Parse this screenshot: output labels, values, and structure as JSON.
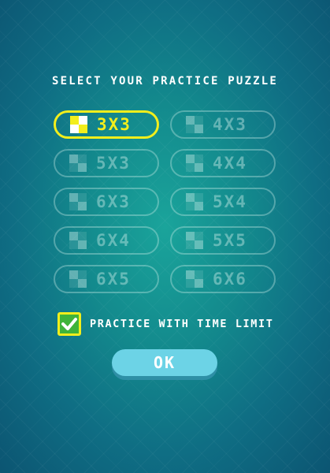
{
  "title": "SELECT YOUR PRACTICE PUZZLE",
  "puzzles": [
    {
      "label": "3X3",
      "selected": true
    },
    {
      "label": "4X3",
      "selected": false
    },
    {
      "label": "5X3",
      "selected": false
    },
    {
      "label": "4X4",
      "selected": false
    },
    {
      "label": "6X3",
      "selected": false
    },
    {
      "label": "5X4",
      "selected": false
    },
    {
      "label": "6X4",
      "selected": false
    },
    {
      "label": "5X5",
      "selected": false
    },
    {
      "label": "6X5",
      "selected": false
    },
    {
      "label": "6X6",
      "selected": false
    }
  ],
  "time_limit": {
    "label": "PRACTICE WITH TIME LIMIT",
    "checked": true
  },
  "ok_label": "OK",
  "colors": {
    "selected": "#f2ee1c",
    "ok_button": "#6cd3e6",
    "checkbox": "#3fb43a"
  }
}
